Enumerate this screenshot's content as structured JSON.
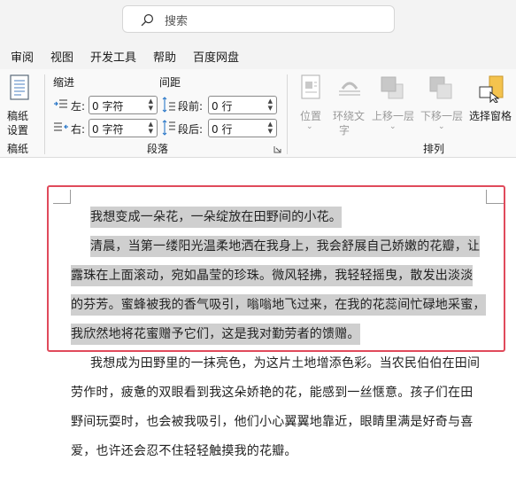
{
  "search": {
    "label": "搜索",
    "icon": "search-icon"
  },
  "menu": [
    "审阅",
    "视图",
    "开发工具",
    "帮助",
    "百度网盘"
  ],
  "ribbon": {
    "paper": {
      "button_line1": "稿纸",
      "button_line2": "设置",
      "group": "稿纸"
    },
    "paragraph": {
      "indent_title": "缩进",
      "spacing_title": "间距",
      "left_label": "左:",
      "right_label": "右:",
      "before_label": "段前:",
      "after_label": "段后:",
      "left_value": "0 字符",
      "right_value": "0 字符",
      "before_value": "0 行",
      "after_value": "0 行",
      "group": "段落"
    },
    "arrange": {
      "position": "位置",
      "wrap_line1": "环绕文",
      "wrap_line2": "字",
      "bring_forward": "上移一层",
      "send_backward": "下移一层",
      "selection_pane": "选择窗格",
      "group": "排列"
    }
  },
  "document": {
    "lines": [
      "我想变成一朵花，一朵绽放在田野间的小花。",
      "清晨，当第一缕阳光温柔地洒在我身上，我会舒展自己娇嫩的花瓣，让",
      "露珠在上面滚动，宛如晶莹的珍珠。微风轻拂，我轻轻摇曳，散发出淡淡",
      "的芬芳。蜜蜂被我的香气吸引，嗡嗡地飞过来，在我的花蕊间忙碌地采蜜，",
      "我欣然地将花蜜赠予它们，这是我对勤劳者的馈赠。",
      "我想成为田野里的一抹亮色，为这片土地增添色彩。当农民伯伯在田间",
      "劳作时，疲惫的双眼看到我这朵娇艳的花，能感到一丝惬意。孩子们在田",
      "野间玩耍时，也会被我吸引，他们小心翼翼地靠近，眼睛里满是好奇与喜",
      "爱，也许还会忍不住轻轻触摸我的花瓣。"
    ]
  }
}
